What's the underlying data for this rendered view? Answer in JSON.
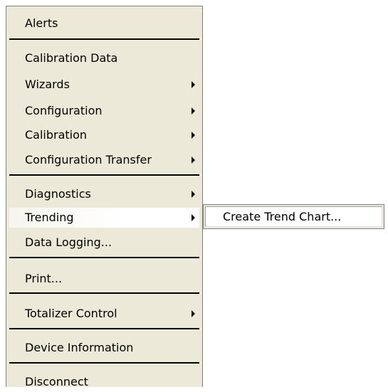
{
  "menu": {
    "items": [
      {
        "label": "Alerts"
      },
      {
        "label": "Calibration Data"
      },
      {
        "label": "Wizards"
      },
      {
        "label": "Configuration"
      },
      {
        "label": "Calibration"
      },
      {
        "label": "Configuration Transfer"
      },
      {
        "label": "Diagnostics"
      },
      {
        "label": "Trending"
      },
      {
        "label": "Data Logging..."
      },
      {
        "label": "Print..."
      },
      {
        "label": "Totalizer Control"
      },
      {
        "label": "Device Information"
      },
      {
        "label": "Disconnect"
      }
    ]
  },
  "submenu": {
    "items": [
      {
        "label": "Create Trend Chart..."
      }
    ]
  },
  "colors": {
    "menu_background": "#ece9d8",
    "separator": "#000000",
    "highlight": "#ffffff"
  }
}
